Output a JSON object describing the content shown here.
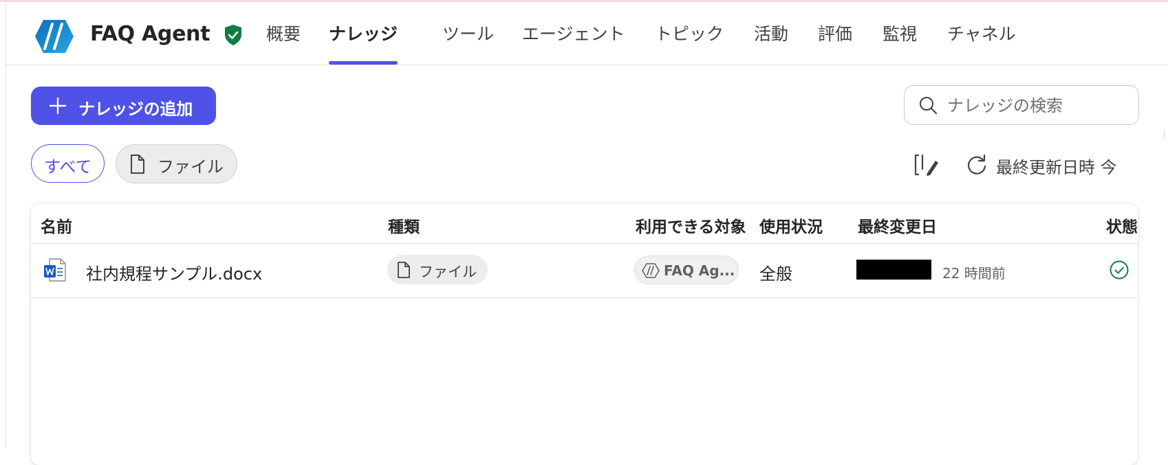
{
  "app": {
    "title": "FAQ Agent",
    "logo_icon": "agent-logo",
    "verified_icon": "shield-check-icon",
    "brand_color": "#4f52e6",
    "verified_color": "#107c41"
  },
  "tabs": [
    {
      "label": "概要",
      "active": false
    },
    {
      "label": "ナレッジ",
      "active": true
    },
    {
      "label": "ツール",
      "active": false
    },
    {
      "label": "エージェント",
      "active": false
    },
    {
      "label": "トピック",
      "active": false
    },
    {
      "label": "活動",
      "active": false
    },
    {
      "label": "評価",
      "active": false
    },
    {
      "label": "監視",
      "active": false
    },
    {
      "label": "チャネル",
      "active": false
    }
  ],
  "toolbar": {
    "add_label": "ナレッジの追加",
    "search_placeholder": "ナレッジの検索",
    "search_value": "",
    "last_updated_label": "最終更新日時 今"
  },
  "filters": {
    "all_label": "すべて",
    "file_label": "ファイル",
    "selected": "すべて"
  },
  "table": {
    "columns": [
      "名前",
      "種類",
      "利用できる対象",
      "使用状況",
      "最終変更日",
      "状態"
    ],
    "rows": [
      {
        "name": "社内規程サンプル.docx",
        "file_icon": "word-doc-icon",
        "type": "ファイル",
        "available_to": "FAQ Ag...",
        "usage": "全般",
        "modified_redacted": true,
        "modified_relative": "22 時間前",
        "status_icon": "check-circle-icon",
        "status_color": "#107c41"
      }
    ]
  }
}
